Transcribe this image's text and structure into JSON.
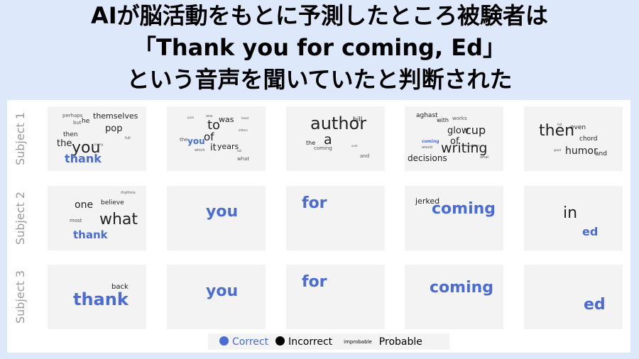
{
  "title_lines": [
    "AIが脳活動をもとに予測したところ被験者は",
    "「Thank you for coming, Ed」",
    "という音声を聞いていたと判断された"
  ],
  "row_labels": [
    "Subject 1",
    "Subject 2",
    "Subject 3"
  ],
  "colors": {
    "correct": "#4a6cd4",
    "incorrect": "#000000",
    "background": "#dde8fa"
  },
  "grid": [
    [
      [
        {
          "t": "perhaps"
        },
        {
          "t": "but"
        },
        {
          "t": "he"
        },
        {
          "t": "themselves"
        },
        {
          "t": "pop"
        },
        {
          "t": "then"
        },
        {
          "t": "full"
        },
        {
          "t": "the"
        },
        {
          "t": "loving"
        },
        {
          "t": "you"
        },
        {
          "t": "thank",
          "c": true
        }
      ],
      [
        {
          "t": "pure"
        },
        {
          "t": "one"
        },
        {
          "t": "was"
        },
        {
          "t": "head"
        },
        {
          "t": "to"
        },
        {
          "t": "letters"
        },
        {
          "t": "the"
        },
        {
          "t": "you",
          "c": true
        },
        {
          "t": "of"
        },
        {
          "t": "years"
        },
        {
          "t": "it"
        },
        {
          "t": "which"
        },
        {
          "t": "tail"
        },
        {
          "t": "what"
        }
      ],
      [
        {
          "t": "author"
        },
        {
          "t": "bill"
        },
        {
          "t": "a"
        },
        {
          "t": "the"
        },
        {
          "t": "coming"
        },
        {
          "t": "sure"
        },
        {
          "t": "and"
        }
      ],
      [
        {
          "t": "aghast"
        },
        {
          "t": "with"
        },
        {
          "t": "works"
        },
        {
          "t": "glow"
        },
        {
          "t": "cup"
        },
        {
          "t": "of"
        },
        {
          "t": "another"
        },
        {
          "t": "coming",
          "c": true
        },
        {
          "t": "would"
        },
        {
          "t": "writing"
        },
        {
          "t": "decisions"
        },
        {
          "t": "what"
        }
      ],
      [
        {
          "t": "then"
        },
        {
          "t": "felt"
        },
        {
          "t": "even"
        },
        {
          "t": "chord"
        },
        {
          "t": "good"
        },
        {
          "t": "humor"
        },
        {
          "t": "and"
        }
      ]
    ],
    [
      [
        {
          "t": "rhythms"
        },
        {
          "t": "one"
        },
        {
          "t": "believe"
        },
        {
          "t": "most"
        },
        {
          "t": "what"
        },
        {
          "t": "thank",
          "c": true
        }
      ],
      [
        {
          "t": "you",
          "c": true
        }
      ],
      [
        {
          "t": "for",
          "c": true
        }
      ],
      [
        {
          "t": "jerked"
        },
        {
          "t": "coming",
          "c": true
        }
      ],
      [
        {
          "t": "in"
        },
        {
          "t": "ed",
          "c": true
        }
      ]
    ],
    [
      [
        {
          "t": "back"
        },
        {
          "t": "thank",
          "c": true
        }
      ],
      [
        {
          "t": "you",
          "c": true
        }
      ],
      [
        {
          "t": "for",
          "c": true
        }
      ],
      [
        {
          "t": "coming",
          "c": true
        }
      ],
      [
        {
          "t": "ed",
          "c": true
        }
      ]
    ]
  ],
  "legend": {
    "correct": "Correct",
    "incorrect": "Incorrect",
    "improbable": "improbable",
    "probable": "Probable"
  }
}
